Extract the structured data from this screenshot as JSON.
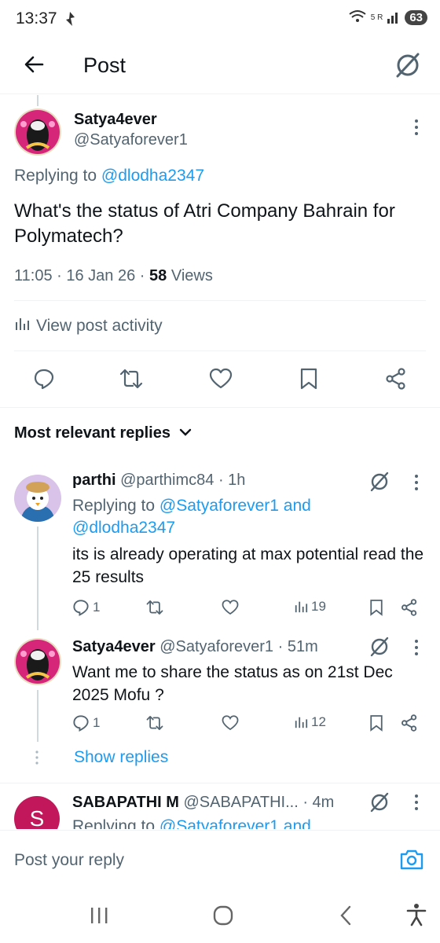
{
  "status_bar": {
    "time": "13:37",
    "battery": "63",
    "signal": "5 R"
  },
  "header": {
    "title": "Post"
  },
  "main_post": {
    "author_name": "Satya4ever",
    "author_handle": "@Satyaforever1",
    "replying_prefix": "Replying to",
    "replying_to": "@dlodha2347",
    "text": "What's the status of Atri Company Bahrain for Polymatech?",
    "time": "11:05",
    "date": "16 Jan 26",
    "views_count": "58",
    "views_label": "Views",
    "view_activity": "View post activity"
  },
  "replies_sort": {
    "label": "Most relevant replies"
  },
  "replies": [
    {
      "name": "parthi",
      "handle": "@parthimc84",
      "time": "1h",
      "replying_prefix": "Replying to",
      "replying_to": "@Satyaforever1 and @dlodha2347",
      "text": "its is already operating at max potential read the 25 results",
      "reply_count": "1",
      "views": "19"
    },
    {
      "name": "Satya4ever",
      "handle": "@Satyaforever1",
      "time": "51m",
      "text": "Want me to share the status as on 21st Dec 2025 Mofu ?",
      "reply_count": "1",
      "views": "12",
      "show_replies": "Show replies"
    },
    {
      "name": "SABAPATHI M",
      "handle": "@SABAPATHI...",
      "time": "4m",
      "avatar_letter": "S",
      "replying_prefix": "Replying to",
      "replying_to": "@Satyaforever1 and"
    }
  ],
  "composer": {
    "placeholder": "Post your reply"
  },
  "colors": {
    "accent": "#1d9bf0",
    "text": "#0f1419",
    "secondary": "#536471",
    "avatar_s": "#c2185b"
  },
  "icons": [
    "back-arrow-icon",
    "grok-icon",
    "more-icon",
    "reply-icon",
    "repost-icon",
    "like-icon",
    "bookmark-icon",
    "share-icon",
    "views-icon",
    "camera-icon"
  ]
}
